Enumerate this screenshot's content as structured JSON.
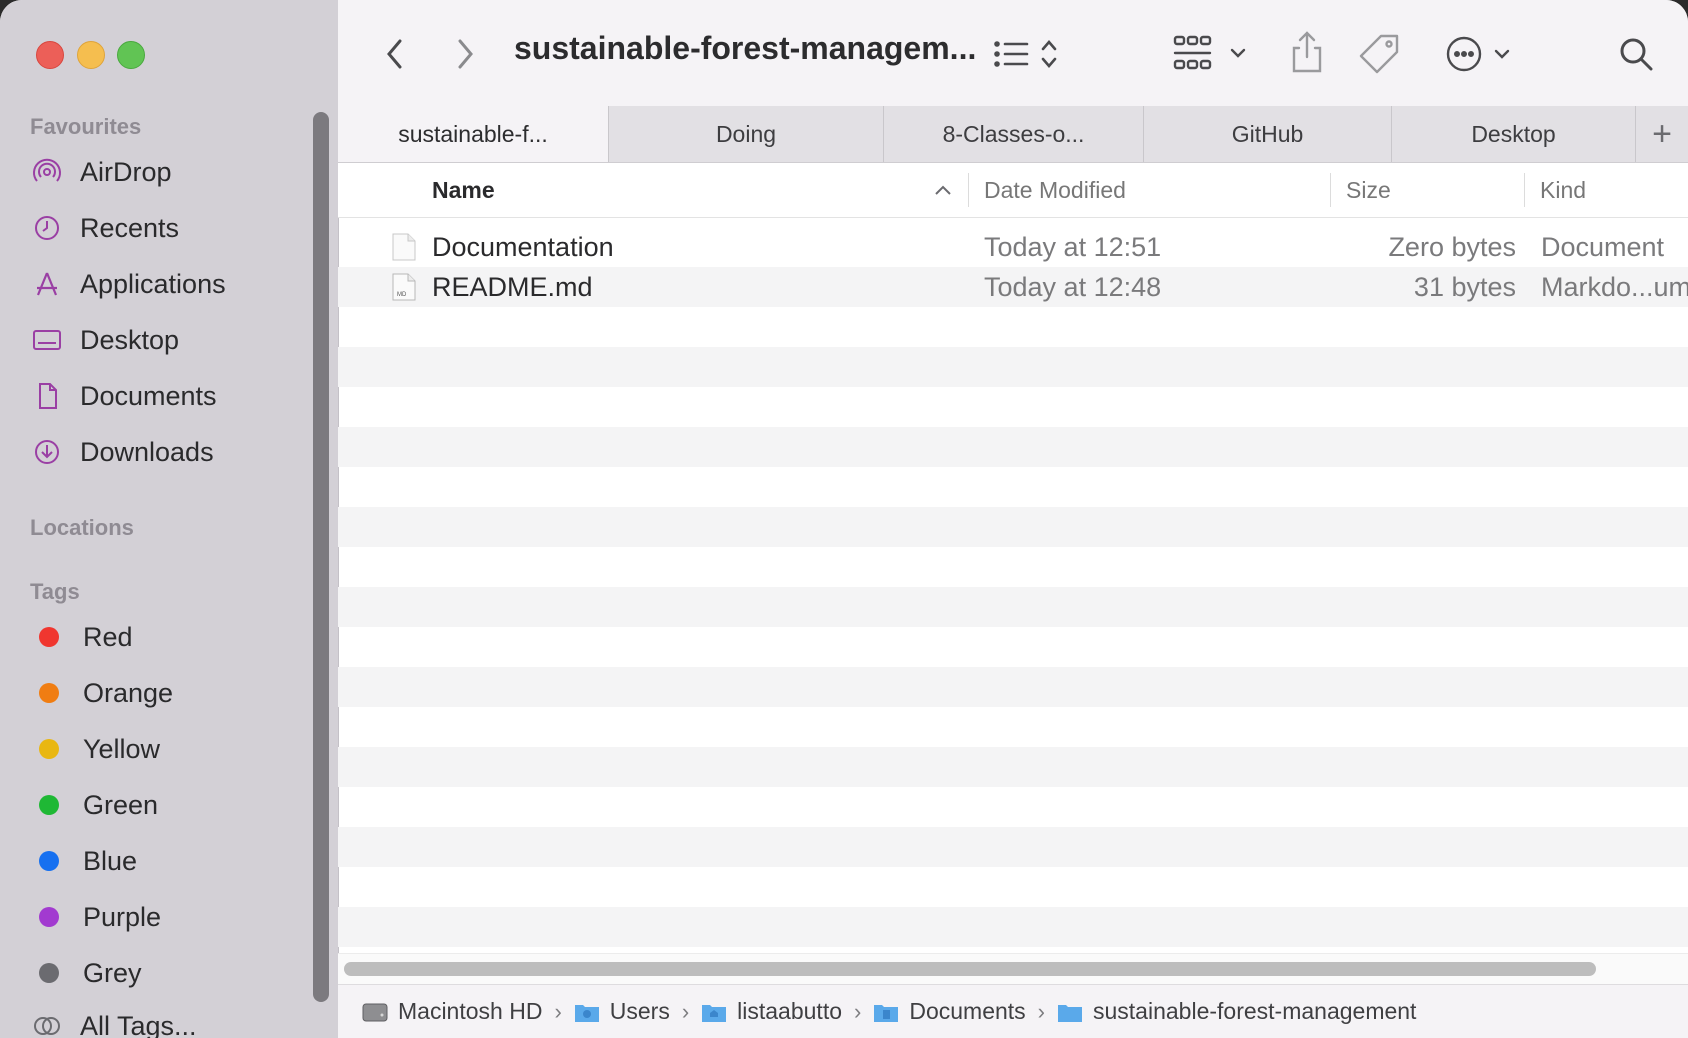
{
  "window": {
    "title": "sustainable-forest-managem..."
  },
  "sidebar": {
    "favourites_heading": "Favourites",
    "favourites": [
      {
        "label": "AirDrop",
        "icon": "airdrop-icon"
      },
      {
        "label": "Recents",
        "icon": "clock-icon"
      },
      {
        "label": "Applications",
        "icon": "applications-icon"
      },
      {
        "label": "Desktop",
        "icon": "desktop-icon"
      },
      {
        "label": "Documents",
        "icon": "document-icon"
      },
      {
        "label": "Downloads",
        "icon": "download-icon"
      }
    ],
    "locations_heading": "Locations",
    "tags_heading": "Tags",
    "tags": [
      {
        "label": "Red",
        "color": "#f0362f"
      },
      {
        "label": "Orange",
        "color": "#f07d12"
      },
      {
        "label": "Yellow",
        "color": "#e9b712"
      },
      {
        "label": "Green",
        "color": "#1fb835"
      },
      {
        "label": "Blue",
        "color": "#1670f0"
      },
      {
        "label": "Purple",
        "color": "#a23ad0"
      },
      {
        "label": "Grey",
        "color": "#6b6b70"
      }
    ],
    "all_tags": "All Tags..."
  },
  "tabs": [
    {
      "label": "sustainable-f...",
      "active": true
    },
    {
      "label": "Doing",
      "active": false
    },
    {
      "label": "8-Classes-o...",
      "active": false
    },
    {
      "label": "GitHub",
      "active": false
    },
    {
      "label": "Desktop",
      "active": false
    }
  ],
  "columns": {
    "name": "Name",
    "date": "Date Modified",
    "size": "Size",
    "kind": "Kind"
  },
  "files": [
    {
      "name": "Documentation",
      "date": "Today at 12:51",
      "size": "Zero bytes",
      "kind": "Document",
      "icon": "blank-file-icon"
    },
    {
      "name": "README.md",
      "date": "Today at 12:48",
      "size": "31 bytes",
      "kind": "Markdo...ument",
      "icon": "markdown-file-icon",
      "icon_label": "MD"
    }
  ],
  "path": [
    {
      "label": "Macintosh HD",
      "icon": "hard-drive-icon"
    },
    {
      "label": "Users",
      "icon": "users-folder-icon"
    },
    {
      "label": "listaabutto",
      "icon": "home-folder-icon"
    },
    {
      "label": "Documents",
      "icon": "documents-folder-icon"
    },
    {
      "label": "sustainable-forest-management",
      "icon": "folder-icon"
    }
  ],
  "colors": {
    "accent_purple": "#9a3fa4",
    "sidebar_bg": "#d3d0d6"
  }
}
